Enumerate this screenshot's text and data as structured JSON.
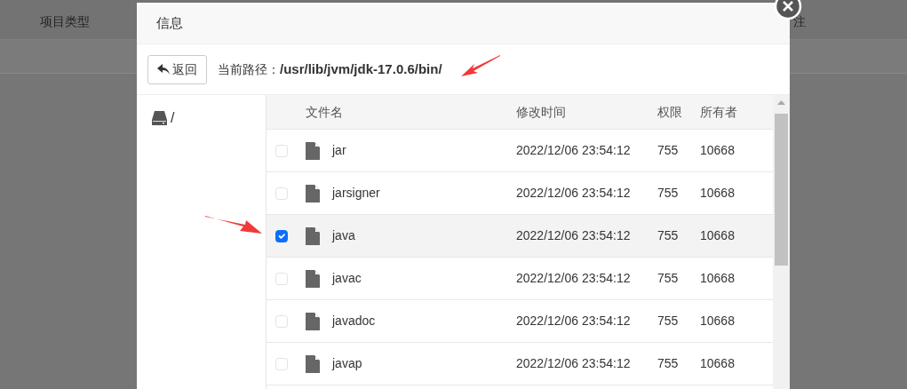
{
  "background": {
    "columns": [
      "项目类型",
      "注"
    ]
  },
  "dialog": {
    "title": "信息",
    "back_button": "返回",
    "path_label": "当前路径：",
    "path": "/usr/lib/jvm/jdk-17.0.6/bin/",
    "sidebar": {
      "items": [
        {
          "label": "/"
        }
      ]
    },
    "table": {
      "columns": [
        "文件名",
        "修改时间",
        "权限",
        "所有者"
      ],
      "rows": [
        {
          "name": "jar",
          "modified": "2022/12/06 23:54:12",
          "permissions": "755",
          "owner": "10668",
          "selected": false
        },
        {
          "name": "jarsigner",
          "modified": "2022/12/06 23:54:12",
          "permissions": "755",
          "owner": "10668",
          "selected": false
        },
        {
          "name": "java",
          "modified": "2022/12/06 23:54:12",
          "permissions": "755",
          "owner": "10668",
          "selected": true
        },
        {
          "name": "javac",
          "modified": "2022/12/06 23:54:12",
          "permissions": "755",
          "owner": "10668",
          "selected": false
        },
        {
          "name": "javadoc",
          "modified": "2022/12/06 23:54:12",
          "permissions": "755",
          "owner": "10668",
          "selected": false
        },
        {
          "name": "javap",
          "modified": "2022/12/06 23:54:12",
          "permissions": "755",
          "owner": "10668",
          "selected": false
        }
      ]
    }
  }
}
